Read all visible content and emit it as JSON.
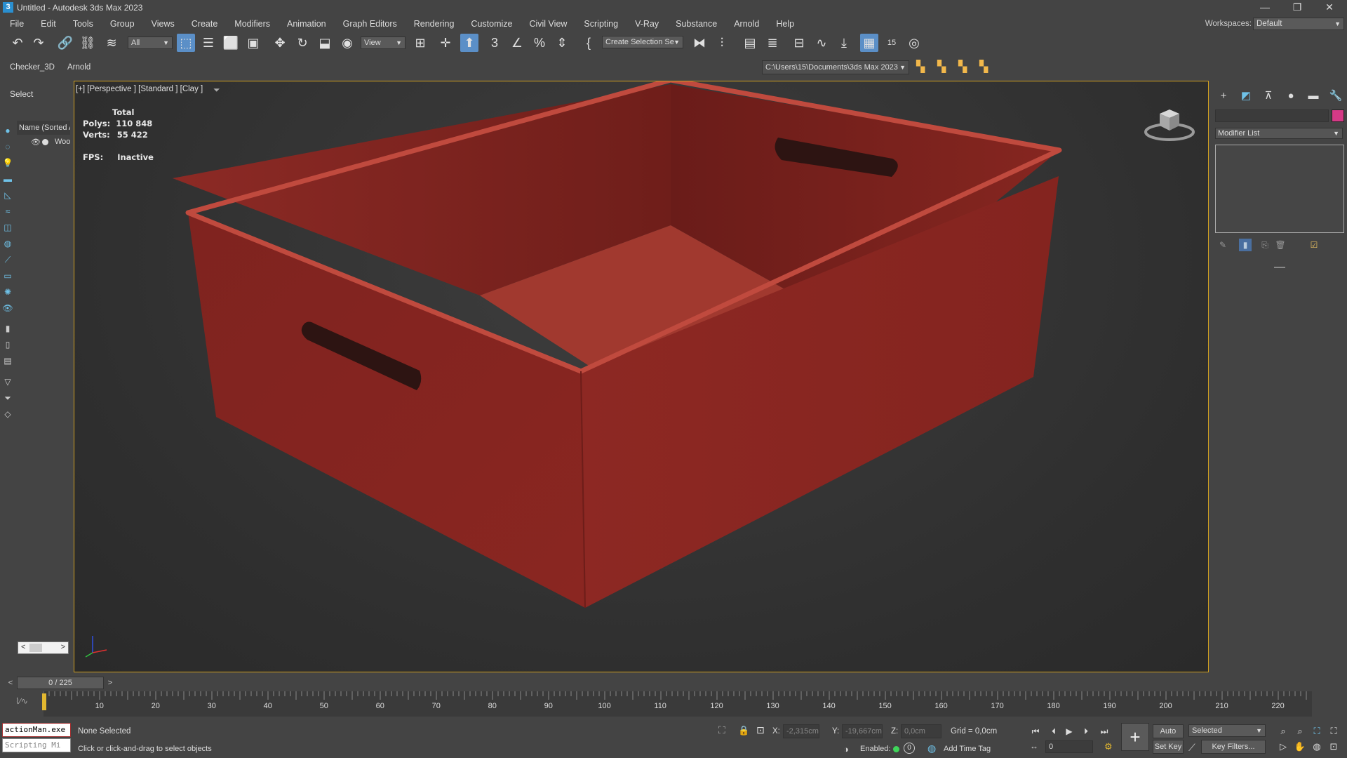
{
  "window": {
    "title": "Untitled - Autodesk 3ds Max 2023",
    "app_icon_text": "3",
    "minimize": "—",
    "restore": "❐",
    "close": "✕"
  },
  "menu": [
    "File",
    "Edit",
    "Tools",
    "Group",
    "Views",
    "Create",
    "Modifiers",
    "Animation",
    "Graph Editors",
    "Rendering",
    "Customize",
    "Civil View",
    "Scripting",
    "V-Ray",
    "Substance",
    "Arnold",
    "Help"
  ],
  "workspace": {
    "label": "Workspaces:",
    "value": "Default"
  },
  "toolbar": {
    "filter_value": "All",
    "ref_coord_value": "View",
    "selection_set_value": "Create Selection Se",
    "angle_snap_value": "15"
  },
  "row2": {
    "tabs": [
      "Checker_3D",
      "Arnold"
    ],
    "project_path": "C:\\Users\\15\\Documents\\3ds Max 2023"
  },
  "scene_explorer": {
    "select_label": "Select",
    "column_header": "Name (Sorted A",
    "item_label": "Woo"
  },
  "viewport": {
    "label": "[+] [Perspective ] [Standard ] [Clay ]",
    "stats_header": "Total",
    "polys_label": "Polys:",
    "polys_value": "110 848",
    "verts_label": "Verts:",
    "verts_value": "55 422",
    "fps_label": "FPS:",
    "fps_value": "Inactive",
    "object_color": "#8b2520"
  },
  "command_panel": {
    "modifier_list": "Modifier List",
    "object_color": "#d53a86"
  },
  "timeline": {
    "frame_display": "0 / 225",
    "ticks": [
      "10",
      "20",
      "30",
      "40",
      "50",
      "60",
      "70",
      "80",
      "90",
      "100",
      "110",
      "120",
      "130",
      "140",
      "150",
      "160",
      "170",
      "180",
      "190",
      "200",
      "210",
      "220"
    ]
  },
  "status": {
    "maxscript_line1": "actionMan.exe",
    "maxscript_line2": "Scripting Mi",
    "selected_text": "None Selected",
    "prompt_text": "Click or click-and-drag to select objects",
    "x_label": "X:",
    "x_value": "-2,315cm",
    "y_label": "Y:",
    "y_value": "-19,667cm",
    "z_label": "Z:",
    "z_value": "0,0cm",
    "grid_text": "Grid = 0,0cm",
    "enabled_label": "Enabled:",
    "enabled_value": "0",
    "add_time_tag": "Add Time Tag",
    "auto_key": "Auto Key",
    "set_key": "Set Key",
    "key_mode_value": "Selected",
    "key_filters": "Key Filters...",
    "current_frame": "0"
  }
}
